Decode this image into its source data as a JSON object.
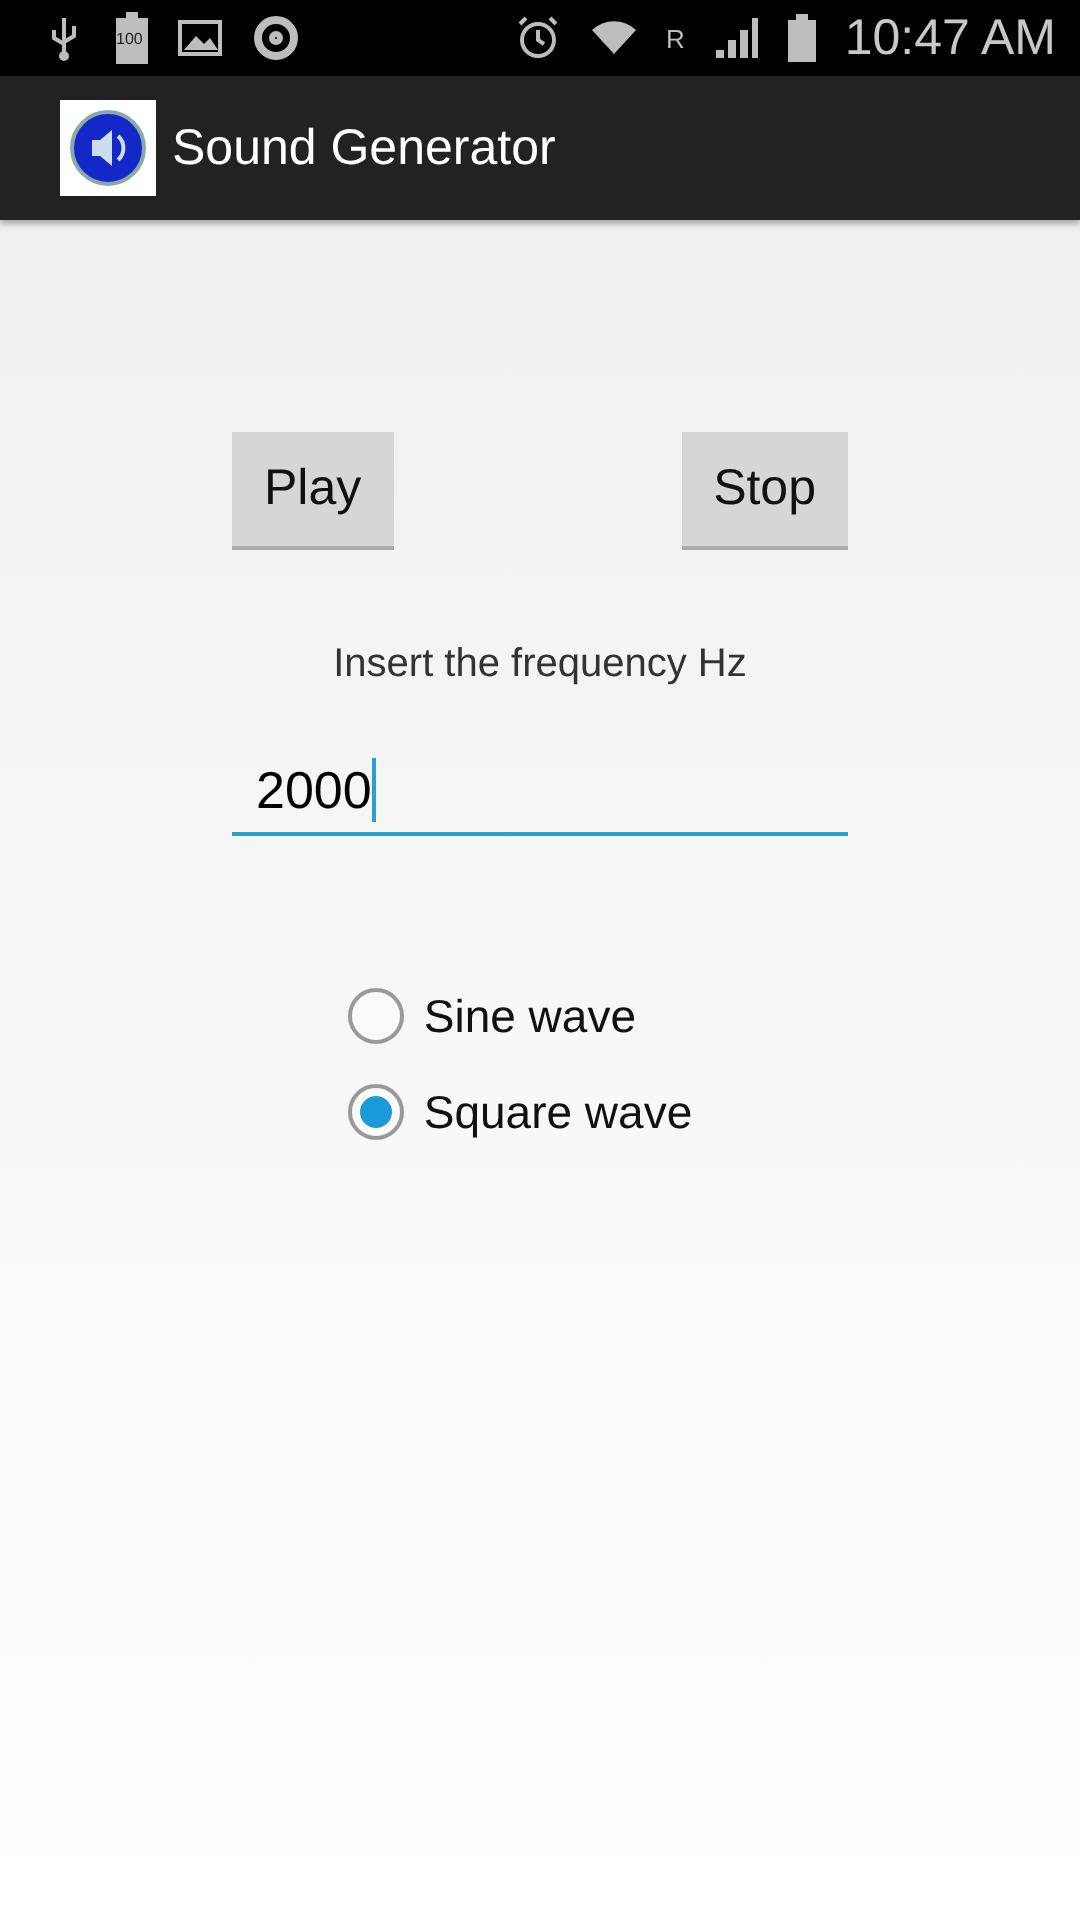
{
  "status_bar": {
    "battery_badge": "100",
    "roaming": "R",
    "time": "10:47 AM"
  },
  "action_bar": {
    "title": "Sound Generator"
  },
  "buttons": [
    {
      "label": "Play"
    },
    {
      "label": "Stop"
    }
  ],
  "frequency": {
    "label": "Insert the frequency Hz",
    "value": "2000",
    "focused": true
  },
  "waves": [
    {
      "label": "Sine wave",
      "selected": false
    },
    {
      "label": "Square wave",
      "selected": true
    }
  ]
}
